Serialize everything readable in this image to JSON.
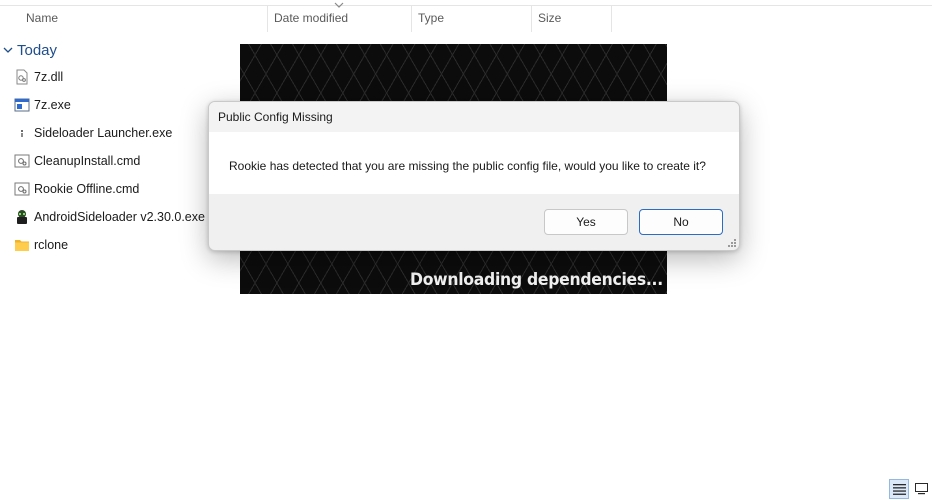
{
  "explorer": {
    "columns": [
      {
        "label": "Name"
      },
      {
        "label": "Date modified"
      },
      {
        "label": "Type"
      },
      {
        "label": "Size"
      }
    ],
    "group": {
      "label": "Today"
    },
    "files": [
      {
        "name": "7z.dll",
        "icon": "dll-file-icon"
      },
      {
        "name": "7z.exe",
        "icon": "exe-window-icon"
      },
      {
        "name": "Sideloader Launcher.exe",
        "icon": "app-icon"
      },
      {
        "name": "CleanupInstall.cmd",
        "icon": "cmd-file-icon"
      },
      {
        "name": "Rookie Offline.cmd",
        "icon": "cmd-file-icon"
      },
      {
        "name": "AndroidSideloader v2.30.0.exe",
        "icon": "android-robot-icon"
      },
      {
        "name": "rclone",
        "icon": "folder-icon"
      }
    ]
  },
  "splash": {
    "status_text": "Downloading dependencies..."
  },
  "dialog": {
    "title": "Public Config Missing",
    "message": "Rookie has detected that you are missing the public config file, would you like to create it?",
    "yes_label": "Yes",
    "no_label": "No"
  },
  "colors": {
    "group_header": "#1f4e8c",
    "default_button_border": "#2b6cc7",
    "splash_bg": "#0c0c0c"
  }
}
